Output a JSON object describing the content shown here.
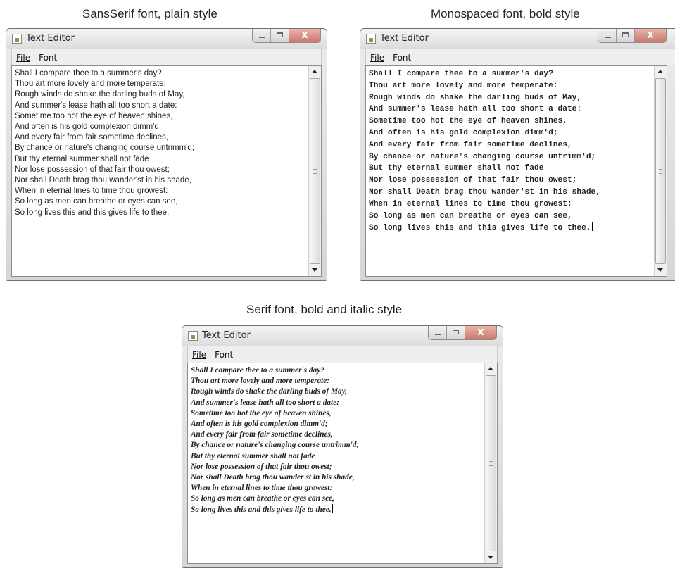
{
  "panels": [
    {
      "caption": "SansSerif font, plain style",
      "window": {
        "title": "Text Editor",
        "close_glyph": "X",
        "menu": {
          "file": "File",
          "font": "Font"
        },
        "lines": [
          "Shall I compare thee to a summer's day?",
          "Thou art more lovely and more temperate:",
          "Rough winds do shake the darling buds of May,",
          "And summer's lease hath all too short a date:",
          "Sometime too hot the eye of heaven shines,",
          "And often is his gold complexion dimm'd;",
          "And every fair from fair sometime declines,",
          "By chance or nature's changing course untrimm'd;",
          "But thy eternal summer shall not fade",
          "Nor lose possession of that fair thou owest;",
          "Nor shall Death brag thou wander'st in his shade,",
          "When in eternal lines to time thou growest:",
          "So long as men can breathe or eyes can see,",
          "So long lives this and this gives life to thee."
        ]
      }
    },
    {
      "caption": "Monospaced font, bold style",
      "window": {
        "title": "Text Editor",
        "close_glyph": "X",
        "menu": {
          "file": "File",
          "font": "Font"
        },
        "lines": [
          "Shall I compare thee to a summer's day?",
          "Thou art more lovely and more temperate:",
          "Rough winds do shake the darling buds of May,",
          "And summer's lease hath all too short a date:",
          "Sometime too hot the eye of heaven shines,",
          "And often is his gold complexion dimm'd;",
          "And every fair from fair sometime declines,",
          "By chance or nature's changing course untrimm'd;",
          "But thy eternal summer shall not fade",
          "Nor lose possession of that fair thou owest;",
          "Nor shall Death brag thou wander'st in his shade,",
          "When in eternal lines to time thou growest:",
          "So long as men can breathe or eyes can see,",
          "So long lives this and this gives life to thee."
        ]
      }
    },
    {
      "caption": "Serif font, bold and italic style",
      "window": {
        "title": "Text Editor",
        "close_glyph": "X",
        "menu": {
          "file": "File",
          "font": "Font"
        },
        "lines": [
          "Shall I compare thee to a summer's day?",
          "Thou art more lovely and more temperate:",
          "Rough winds do shake the darling buds of May,",
          "And summer's lease hath all too short a date:",
          "Sometime too hot the eye of heaven shines,",
          "And often is his gold complexion dimm'd;",
          "And every fair from fair sometime declines,",
          "By chance or nature's changing course untrimm'd;",
          "But thy eternal summer shall not fade",
          "Nor lose possession of that fair thou owest;",
          "Nor shall Death brag thou wander'st in his shade,",
          "When in eternal lines to time thou growest:",
          "So long as men can breathe or eyes can see,",
          "So long lives this and this gives life to thee."
        ]
      }
    }
  ]
}
